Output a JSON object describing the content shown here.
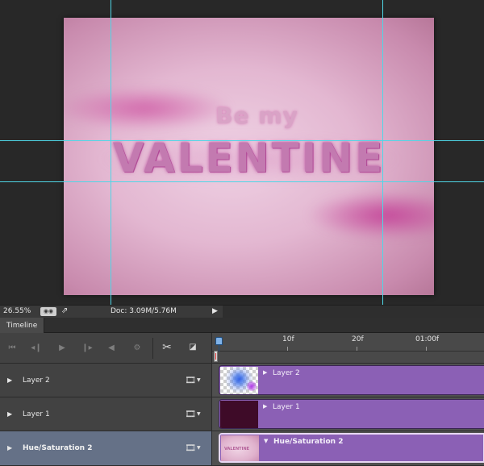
{
  "canvas": {
    "artwork": {
      "line1": "Be my",
      "line2": "VALENTINE",
      "colors": {
        "background": "#e8c2da",
        "glitter": "#c03d93",
        "text": "#c37ab0"
      }
    },
    "guide_color": "#4fd6e6"
  },
  "status_bar": {
    "zoom": "26.55%",
    "doc_info": "Doc: 3.09M/5.76M",
    "icons": [
      "view-toggle-icon",
      "share-icon",
      "expand-arrow-icon"
    ]
  },
  "timeline": {
    "tab_label": "Timeline",
    "controls": {
      "icons": [
        "go-to-first-frame-icon",
        "previous-frame-icon",
        "play-icon",
        "next-frame-icon",
        "audio-icon",
        "settings-gear-icon",
        "scissors-icon",
        "transition-icon"
      ]
    },
    "ruler": {
      "labels": [
        "10f",
        "20f",
        "01:00f"
      ]
    },
    "tracks": [
      {
        "name": "Layer 2",
        "clip_label": "Layer 2",
        "selected": false
      },
      {
        "name": "Layer 1",
        "clip_label": "Layer 1",
        "selected": false
      },
      {
        "name": "Hue/Saturation 2",
        "clip_label": "Hue/Saturation 2",
        "selected": true
      }
    ],
    "colors": {
      "clip": "#8b60b5",
      "selected_track": "#657187",
      "playhead": "#7fb2e8"
    }
  }
}
